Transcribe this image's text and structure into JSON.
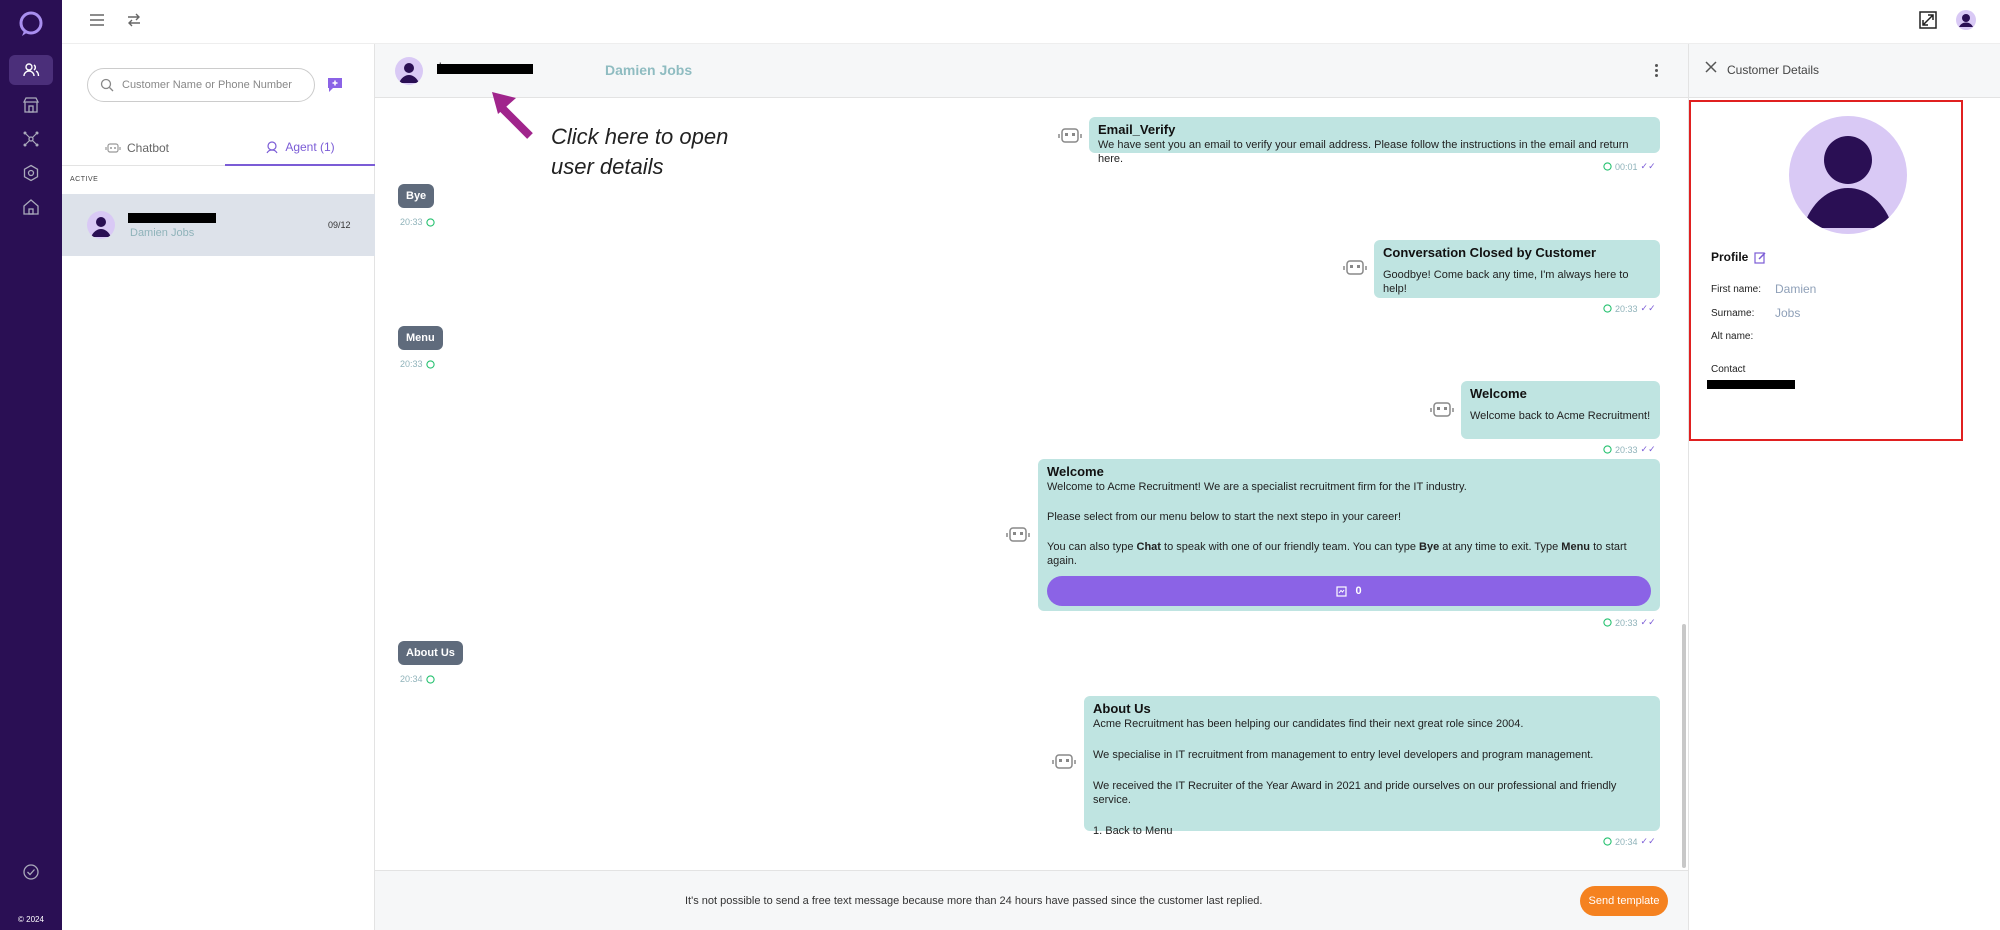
{
  "rail": {
    "copyright": "© 2024",
    "accent": "#2a0f54",
    "items": [
      "contacts-icon",
      "store-icon",
      "network-icon",
      "settings-icon",
      "home-icon"
    ],
    "bottom_item": "check-circle-icon"
  },
  "list": {
    "search_placeholder": "Customer Name or Phone Number",
    "tabs": [
      {
        "label": "Chatbot",
        "active": false
      },
      {
        "label": "Agent (1)",
        "active": true
      }
    ],
    "section": "ACTIVE",
    "conversations": [
      {
        "name": "Damien Jobs",
        "date": "09/12"
      }
    ]
  },
  "chat_header": {
    "phone_prefix": "+",
    "name": "Damien Jobs"
  },
  "annotation": {
    "line1": "Click here to open",
    "line2": "user details"
  },
  "messages": {
    "m1": {
      "title": "Email_Verify",
      "text": "We have sent you an email to verify your email address. Please follow the instructions in the email and return here.",
      "time": "00:01"
    },
    "m2": {
      "text": "Bye",
      "time": "20:33"
    },
    "m3": {
      "title": "Conversation Closed by Customer",
      "text": "Goodbye! Come back any time, I'm always here to help!",
      "time": "20:33"
    },
    "m4": {
      "text": "Menu",
      "time": "20:33"
    },
    "m5": {
      "title": "Welcome",
      "text": "Welcome back to Acme Recruitment!",
      "time": "20:33"
    },
    "m6": {
      "title": "Welcome",
      "line1": "Welcome to Acme Recruitment! We are a specialist recruitment firm for the IT industry.",
      "line2": "Please select from our menu below to start the next stepo in your career!",
      "line3a": "You can also type ",
      "line3b": "Chat",
      "line3c": " to speak with one of our friendly team. You can type ",
      "line3d": "Bye",
      "line3e": " at any time to exit. Type ",
      "line3f": "Menu",
      "line3g": " to start again.",
      "button": "0",
      "time": "20:33"
    },
    "m7": {
      "text": "About Us",
      "time": "20:34"
    },
    "m8": {
      "title": "About Us",
      "line1": "Acme Recruitment has been helping our candidates find their next great role since 2004.",
      "line2": "We specialise in IT recruitment from management to entry level developers and program management.",
      "line3": "We received the IT Recruiter of the Year Award in 2021 and pride ourselves on our professional and friendly service.",
      "line4": "1.  Back to Menu",
      "time": "20:34"
    }
  },
  "footer": {
    "notice": "It's not possible to send a free text message because more than 24 hours have passed since the customer last replied.",
    "send_template": "Send template",
    "button_color": "#f58220"
  },
  "details": {
    "title": "Customer Details",
    "profile": "Profile",
    "first_name_label": "First name:",
    "first_name": "Damien",
    "surname_label": "Surname:",
    "surname": "Jobs",
    "alt_name_label": "Alt name:",
    "contact_label": "Contact",
    "highlight_color": "#e02020"
  },
  "colors": {
    "bubble_out": "#bfe4e1",
    "bubble_in": "#5f6b7c",
    "accent_purple": "#8b63e6"
  }
}
